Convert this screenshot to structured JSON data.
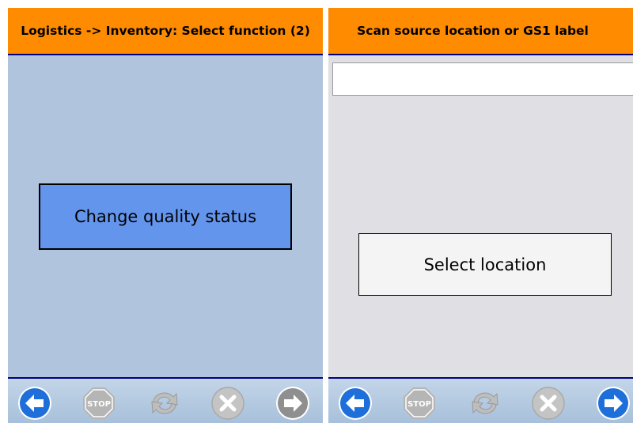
{
  "screen1": {
    "header": "Logistics -> Inventory: Select function (2)",
    "action_button": "Change quality status",
    "footer": {
      "back": "back-arrow-icon",
      "stop": "STOP",
      "refresh": "refresh-icon",
      "cancel": "cancel-x-icon",
      "next": "next-arrow-icon"
    }
  },
  "screen2": {
    "header": "Scan source location or GS1 label",
    "input_value": "",
    "action_button": "Select location",
    "footer": {
      "back": "back-arrow-icon",
      "stop": "STOP",
      "refresh": "refresh-icon",
      "cancel": "cancel-x-icon",
      "next": "next-arrow-icon"
    }
  },
  "colors": {
    "header_bg": "#ff8c00",
    "screen1_bg": "#b0c4de",
    "screen2_bg": "#e0dfe4",
    "divider": "#000080",
    "primary_button": "#6495ed",
    "active_icon": "#1e6fd9",
    "disabled_icon": "#b5b5b5"
  }
}
